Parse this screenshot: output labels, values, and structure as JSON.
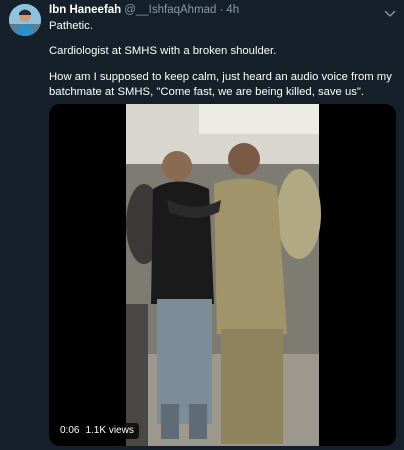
{
  "tweet": {
    "display_name": "Ibn Haneefah",
    "handle": "@__IshfaqAhmad",
    "separator": "·",
    "timestamp": "4h",
    "lines": [
      "Pathetic.",
      "Cardiologist at SMHS with a broken shoulder.",
      "How am I supposed to keep calm, just heard an audio voice from my batchmate at SMHS, \"Come fast, we are being killed, save us\"."
    ]
  },
  "video": {
    "duration": "0:06",
    "views": "1.1K views"
  },
  "icons": {
    "menu": "chevron-down-icon",
    "avatar": "avatar"
  }
}
